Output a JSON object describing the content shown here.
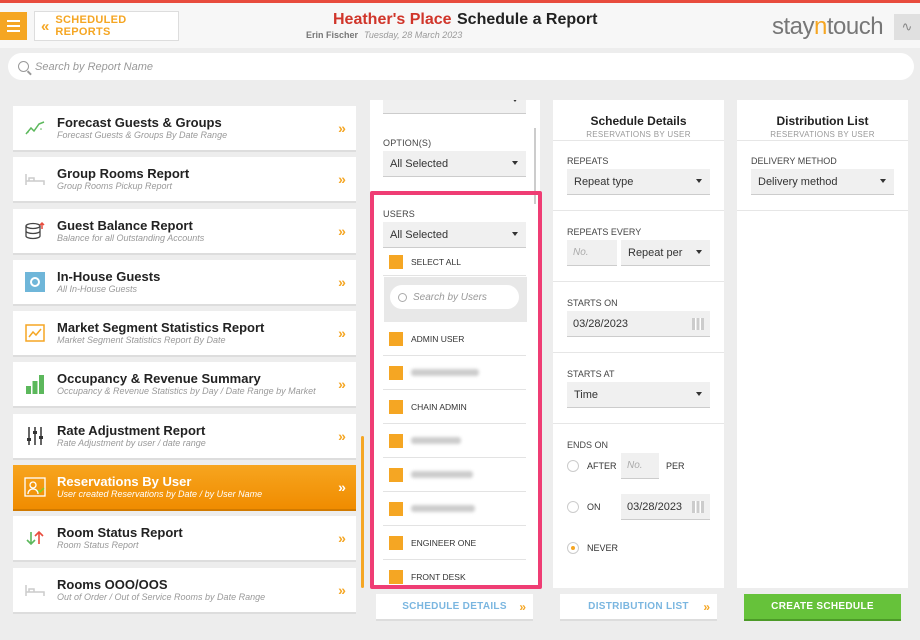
{
  "header": {
    "back_label": "SCHEDULED REPORTS",
    "hotel_name": "Heather's Place",
    "page_title": "Schedule a Report",
    "user_name": "Erin Fischer",
    "date": "Tuesday, 28 March 2023",
    "logo_part1": "stay",
    "logo_part2": "n",
    "logo_part3": "touch"
  },
  "search": {
    "placeholder": "Search by Report Name"
  },
  "reports": [
    {
      "title": "Forecast Guests & Groups",
      "subtitle": "Forecast Guests & Groups By Date Range",
      "icon": "trend-chart-icon"
    },
    {
      "title": "Group Rooms Report",
      "subtitle": "Group Rooms Pickup Report",
      "icon": "bed-icon"
    },
    {
      "title": "Guest Balance Report",
      "subtitle": "Balance for all Outstanding Accounts",
      "icon": "coins-icon"
    },
    {
      "title": "In-House Guests",
      "subtitle": "All In-House Guests",
      "icon": "in-house-icon"
    },
    {
      "title": "Market Segment Statistics Report",
      "subtitle": "Market Segment Statistics Report By Date",
      "icon": "line-chart-icon"
    },
    {
      "title": "Occupancy & Revenue Summary",
      "subtitle": "Occupancy & Revenue Statistics by Day / Date Range by Market",
      "icon": "bar-chart-icon"
    },
    {
      "title": "Rate Adjustment Report",
      "subtitle": "Rate Adjustment by user / date range",
      "icon": "sliders-icon"
    },
    {
      "title": "Reservations By User",
      "subtitle": "User created Reservations by Date / by User Name",
      "icon": "user-reservation-icon"
    },
    {
      "title": "Room Status Report",
      "subtitle": "Room Status Report",
      "icon": "up-down-arrows-icon"
    },
    {
      "title": "Rooms OOO/OOS",
      "subtitle": "Out of Order / Out of Service Rooms by Date Range",
      "icon": "bed-icon"
    }
  ],
  "filters": {
    "options_label": "OPTION(S)",
    "options_value": "All Selected",
    "users_label": "USERS",
    "users_value": "All Selected",
    "select_all": "SELECT ALL",
    "user_search_placeholder": "Search by Users",
    "users": [
      "ADMIN USER",
      "",
      "CHAIN ADMIN",
      "",
      "",
      "",
      "ENGINEER ONE",
      "FRONT DESK"
    ]
  },
  "schedule": {
    "title": "Schedule Details",
    "subtitle": "RESERVATIONS BY USER",
    "repeats_label": "REPEATS",
    "repeats_value": "Repeat type",
    "repeats_every_label": "REPEATS EVERY",
    "no_placeholder": "No.",
    "repeat_per": "Repeat per",
    "starts_on_label": "STARTS ON",
    "starts_on_value": "03/28/2023",
    "starts_at_label": "STARTS AT",
    "starts_at_value": "Time",
    "ends_on_label": "ENDS ON",
    "after_label": "AFTER",
    "per_label": "PER",
    "on_label": "ON",
    "on_value": "03/28/2023",
    "never_label": "NEVER"
  },
  "distribution": {
    "title": "Distribution List",
    "subtitle": "RESERVATIONS BY USER",
    "method_label": "DELIVERY METHOD",
    "method_value": "Delivery method"
  },
  "buttons": {
    "schedule_details": "SCHEDULE DETAILS",
    "distribution_list": "DISTRIBUTION LIST",
    "create": "CREATE SCHEDULE"
  },
  "colors": {
    "accent": "#f5a623",
    "brand_red": "#d0352a",
    "highlight": "#ef3d74",
    "create_green": "#66c23a"
  }
}
